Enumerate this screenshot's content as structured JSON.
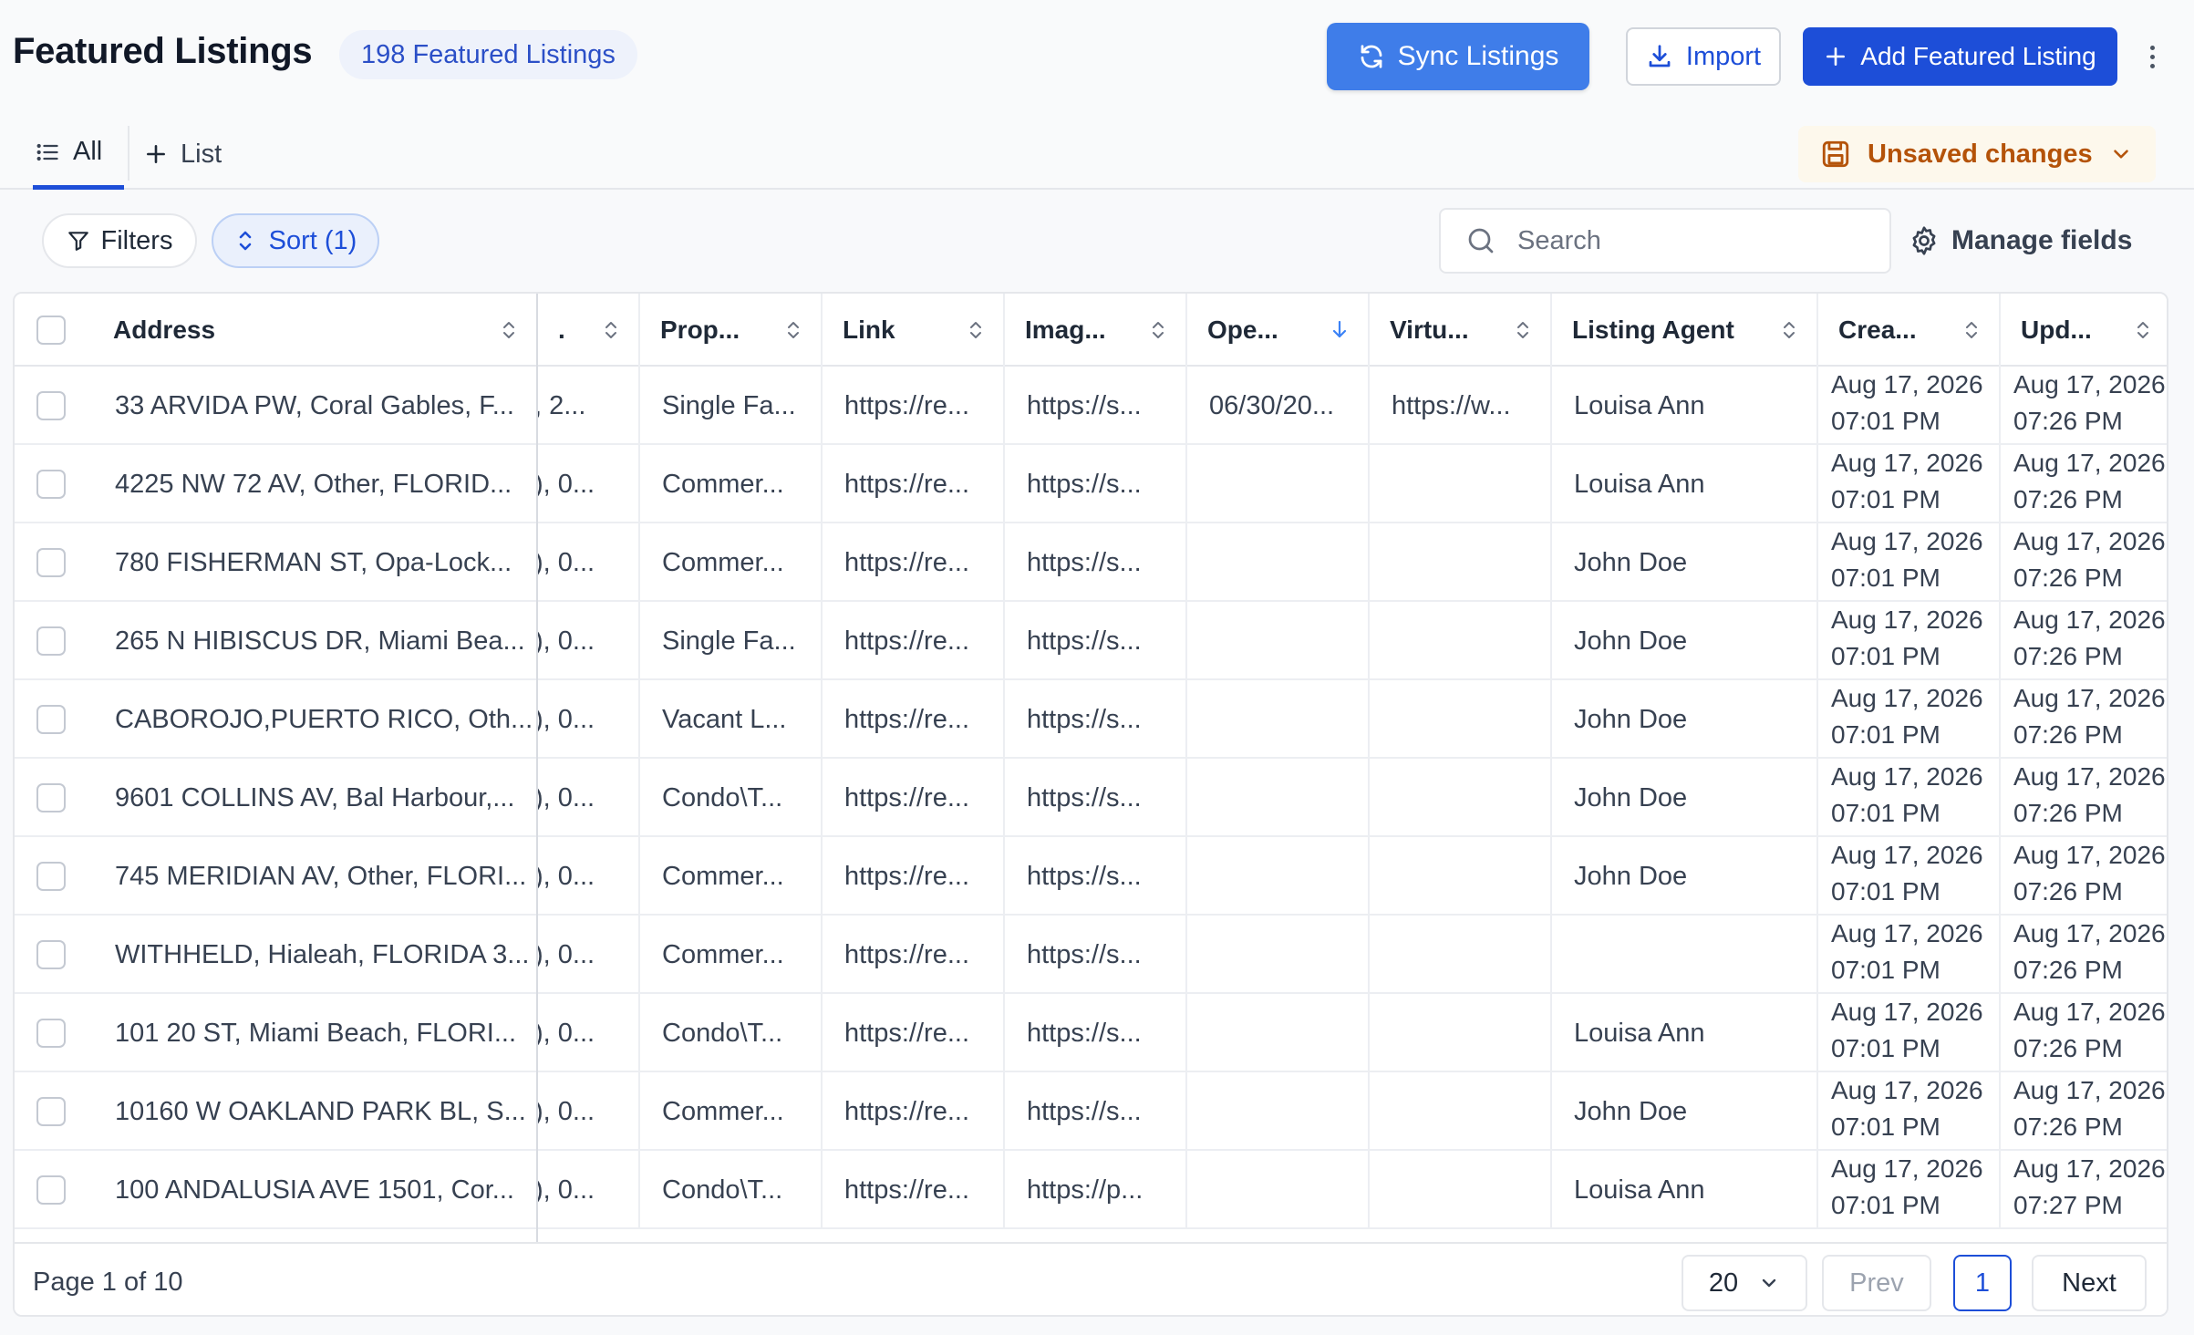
{
  "header": {
    "title": "Featured Listings",
    "count_badge": "198 Featured Listings",
    "sync_label": "Sync Listings",
    "import_label": "Import",
    "add_label": "Add Featured Listing"
  },
  "tabs": {
    "all_label": "All",
    "add_list_label": "List",
    "unsaved_label": "Unsaved changes"
  },
  "toolbar": {
    "filters_label": "Filters",
    "sort_label": "Sort (1)",
    "search_placeholder": "Search",
    "manage_fields_label": "Manage fields"
  },
  "columns": [
    "Address",
    ".",
    "Prop...",
    "Link",
    "Imag...",
    "Ope...",
    "Virtu...",
    "Listing Agent",
    "Crea...",
    "Upd..."
  ],
  "rows": [
    {
      "address": "33 ARVIDA PW, Coral Gables, F...",
      "c2": ", 2...",
      "prop": "Single Fa...",
      "link": "https://re...",
      "image": "https://s...",
      "open": "06/30/20...",
      "virtual": "https://w...",
      "agent": "Louisa Ann",
      "created_date": "Aug 17, 2026",
      "created_time": "07:01 PM",
      "updated_date": "Aug 17, 2026",
      "updated_time": "07:26 PM"
    },
    {
      "address": "4225 NW 72 AV, Other, FLORID...",
      "c2": "), 0...",
      "prop": "Commer...",
      "link": "https://re...",
      "image": "https://s...",
      "open": "",
      "virtual": "",
      "agent": "Louisa Ann",
      "created_date": "Aug 17, 2026",
      "created_time": "07:01 PM",
      "updated_date": "Aug 17, 2026",
      "updated_time": "07:26 PM"
    },
    {
      "address": "780 FISHERMAN ST, Opa-Lock...",
      "c2": "), 0...",
      "prop": "Commer...",
      "link": "https://re...",
      "image": "https://s...",
      "open": "",
      "virtual": "",
      "agent": "John Doe",
      "created_date": "Aug 17, 2026",
      "created_time": "07:01 PM",
      "updated_date": "Aug 17, 2026",
      "updated_time": "07:26 PM"
    },
    {
      "address": "265 N HIBISCUS DR, Miami Bea...",
      "c2": "), 0...",
      "prop": "Single Fa...",
      "link": "https://re...",
      "image": "https://s...",
      "open": "",
      "virtual": "",
      "agent": "John Doe",
      "created_date": "Aug 17, 2026",
      "created_time": "07:01 PM",
      "updated_date": "Aug 17, 2026",
      "updated_time": "07:26 PM"
    },
    {
      "address": "CABOROJO,PUERTO RICO, Oth...",
      "c2": "), 0...",
      "prop": "Vacant L...",
      "link": "https://re...",
      "image": "https://s...",
      "open": "",
      "virtual": "",
      "agent": "John Doe",
      "created_date": "Aug 17, 2026",
      "created_time": "07:01 PM",
      "updated_date": "Aug 17, 2026",
      "updated_time": "07:26 PM"
    },
    {
      "address": "9601 COLLINS AV, Bal Harbour,...",
      "c2": "), 0...",
      "prop": "Condo\\T...",
      "link": "https://re...",
      "image": "https://s...",
      "open": "",
      "virtual": "",
      "agent": "John Doe",
      "created_date": "Aug 17, 2026",
      "created_time": "07:01 PM",
      "updated_date": "Aug 17, 2026",
      "updated_time": "07:26 PM"
    },
    {
      "address": "745 MERIDIAN AV, Other, FLORI...",
      "c2": "), 0...",
      "prop": "Commer...",
      "link": "https://re...",
      "image": "https://s...",
      "open": "",
      "virtual": "",
      "agent": "John Doe",
      "created_date": "Aug 17, 2026",
      "created_time": "07:01 PM",
      "updated_date": "Aug 17, 2026",
      "updated_time": "07:26 PM"
    },
    {
      "address": "WITHHELD, Hialeah, FLORIDA 3...",
      "c2": "), 0...",
      "prop": "Commer...",
      "link": "https://re...",
      "image": "https://s...",
      "open": "",
      "virtual": "",
      "agent": "",
      "created_date": "Aug 17, 2026",
      "created_time": "07:01 PM",
      "updated_date": "Aug 17, 2026",
      "updated_time": "07:26 PM"
    },
    {
      "address": "101 20 ST, Miami Beach, FLORI...",
      "c2": "), 0...",
      "prop": "Condo\\T...",
      "link": "https://re...",
      "image": "https://s...",
      "open": "",
      "virtual": "",
      "agent": "Louisa Ann",
      "created_date": "Aug 17, 2026",
      "created_time": "07:01 PM",
      "updated_date": "Aug 17, 2026",
      "updated_time": "07:26 PM"
    },
    {
      "address": "10160 W OAKLAND PARK BL, S...",
      "c2": "), 0...",
      "prop": "Commer...",
      "link": "https://re...",
      "image": "https://s...",
      "open": "",
      "virtual": "",
      "agent": "John Doe",
      "created_date": "Aug 17, 2026",
      "created_time": "07:01 PM",
      "updated_date": "Aug 17, 2026",
      "updated_time": "07:26 PM"
    },
    {
      "address": "100 ANDALUSIA AVE 1501, Cor...",
      "c2": "), 0...",
      "prop": "Condo\\T...",
      "link": "https://re...",
      "image": "https://p...",
      "open": "",
      "virtual": "",
      "agent": "Louisa Ann",
      "created_date": "Aug 17, 2026",
      "created_time": "07:01 PM",
      "updated_date": "Aug 17, 2026",
      "updated_time": "07:27 PM"
    }
  ],
  "footer": {
    "page_info": "Page 1 of 10",
    "page_size": "20",
    "prev_label": "Prev",
    "current_page": "1",
    "next_label": "Next"
  },
  "colors": {
    "primary": "#1d4ed8",
    "sync": "#3f7de9",
    "unsaved": "#b45309"
  }
}
